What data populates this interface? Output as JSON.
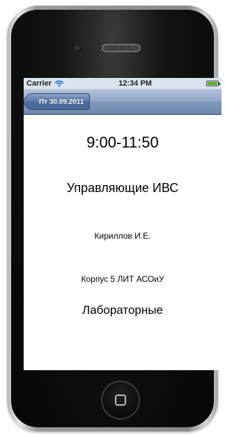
{
  "status_bar": {
    "carrier": "Carrier",
    "time": "12:34 PM"
  },
  "nav": {
    "back_label": "Пт 30.09.2011"
  },
  "lesson": {
    "time": "9:00-11:50",
    "subject": "Управляющие ИВС",
    "teacher": "Кириллов И.Е.",
    "room": "Корпус 5 ЛИТ АСОиУ",
    "type": "Лабораторные"
  },
  "colors": {
    "nav_bar": "#7f97b9",
    "battery": "#4caf1a"
  }
}
